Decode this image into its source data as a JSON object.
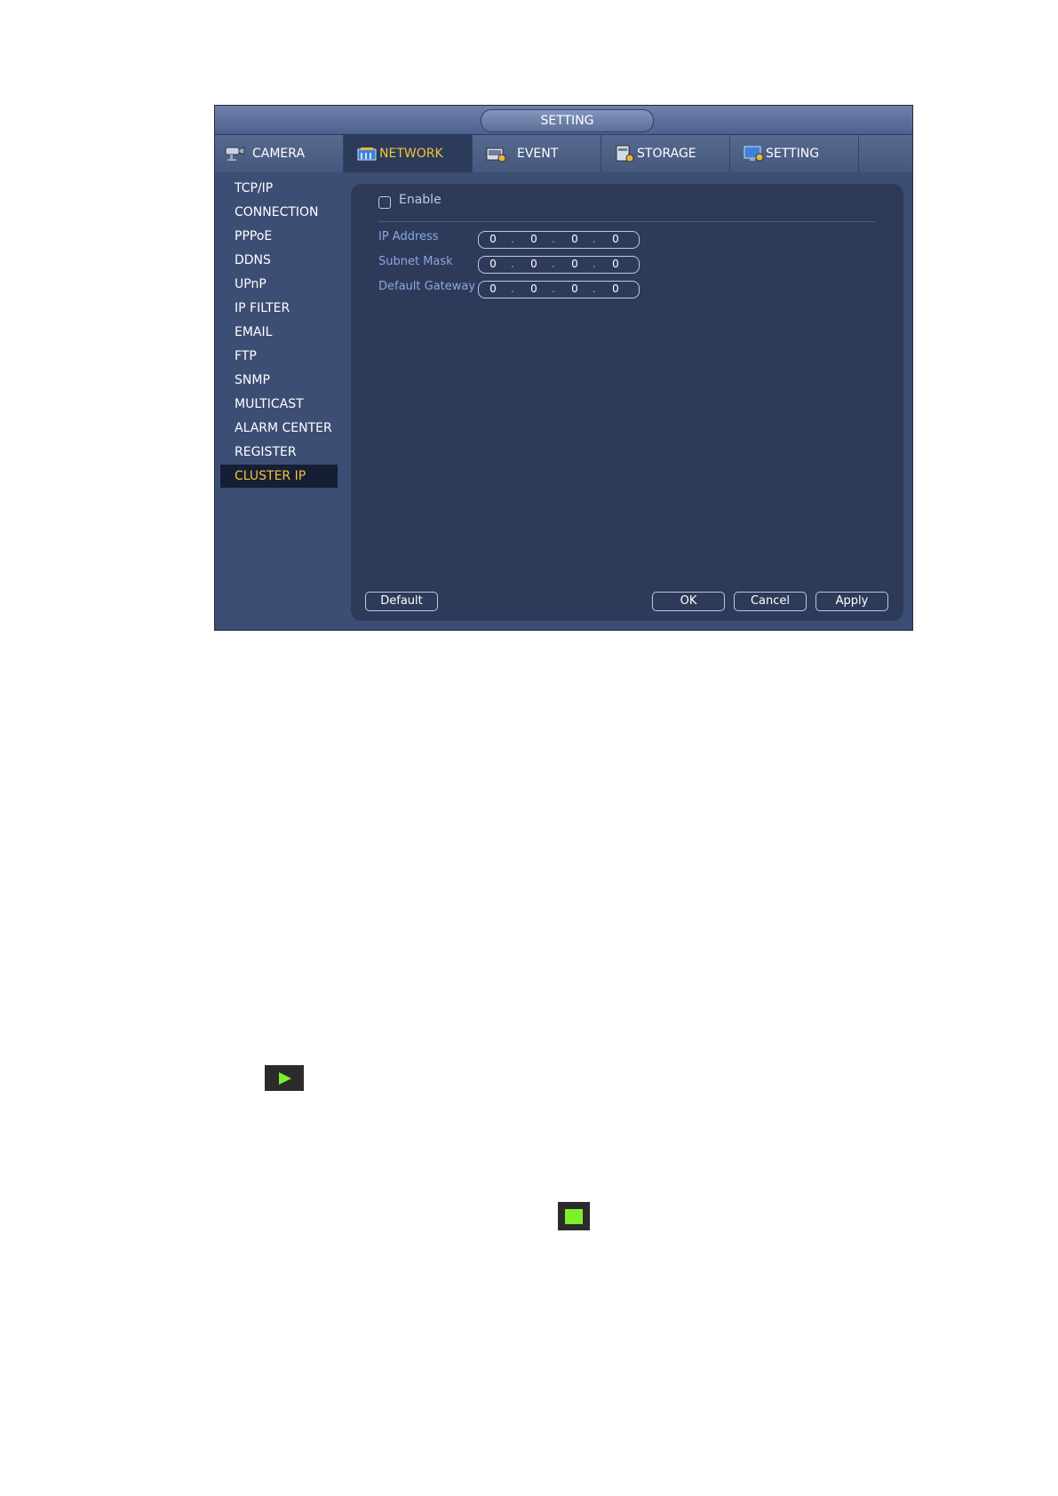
{
  "window": {
    "title": "SETTING"
  },
  "tabs": [
    {
      "label": "CAMERA",
      "icon": "camera-icon",
      "active": false
    },
    {
      "label": "NETWORK",
      "icon": "network-icon",
      "active": true
    },
    {
      "label": "EVENT",
      "icon": "event-icon",
      "active": false
    },
    {
      "label": "STORAGE",
      "icon": "storage-icon",
      "active": false
    },
    {
      "label": "SETTING",
      "icon": "setting-icon",
      "active": false
    }
  ],
  "sidebar": {
    "items": [
      {
        "label": "TCP/IP"
      },
      {
        "label": "CONNECTION"
      },
      {
        "label": "PPPoE"
      },
      {
        "label": "DDNS"
      },
      {
        "label": "UPnP"
      },
      {
        "label": "IP FILTER"
      },
      {
        "label": "EMAIL"
      },
      {
        "label": "FTP"
      },
      {
        "label": "SNMP"
      },
      {
        "label": "MULTICAST"
      },
      {
        "label": "ALARM CENTER"
      },
      {
        "label": "REGISTER"
      },
      {
        "label": "CLUSTER IP",
        "active": true
      }
    ]
  },
  "form": {
    "enable_label": "Enable",
    "enable_checked": false,
    "fields": [
      {
        "label": "IP Address",
        "octets": [
          "0",
          "0",
          "0",
          "0"
        ]
      },
      {
        "label": "Subnet Mask",
        "octets": [
          "0",
          "0",
          "0",
          "0"
        ]
      },
      {
        "label": "Default Gateway",
        "octets": [
          "0",
          "0",
          "0",
          "0"
        ]
      }
    ],
    "ip_separator": "."
  },
  "buttons": {
    "default": "Default",
    "ok": "OK",
    "cancel": "Cancel",
    "apply": "Apply"
  },
  "extra_icons": {
    "play": "play-icon",
    "stop": "green-square-icon"
  },
  "colors": {
    "active_text": "#f3c33b",
    "play_green": "#7df02a"
  }
}
